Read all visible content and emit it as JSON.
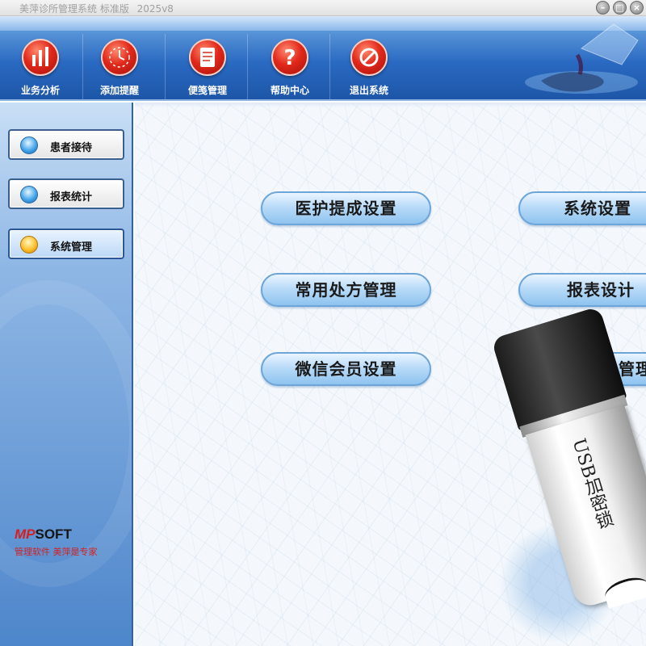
{
  "window": {
    "title": "美萍诊所管理系统 标准版",
    "version": "2025v8"
  },
  "toolbar": {
    "items": [
      {
        "label": "业务分析",
        "icon": "bar-chart-icon"
      },
      {
        "label": "添加提醒",
        "icon": "alarm-clock-icon"
      },
      {
        "label": "便笺管理",
        "icon": "notepad-icon"
      },
      {
        "label": "帮助中心",
        "icon": "question-mark-icon"
      },
      {
        "label": "退出系统",
        "icon": "no-entry-icon"
      }
    ]
  },
  "sidebar": {
    "items": [
      {
        "label": "患者接待",
        "active": false
      },
      {
        "label": "报表统计",
        "active": false
      },
      {
        "label": "系统管理",
        "active": true
      }
    ],
    "brand": {
      "logo_mp": "MP",
      "logo_soft": "SOFT",
      "slogan": "管理软件 美萍是专家"
    }
  },
  "main": {
    "buttons": [
      "医护提成设置",
      "系统设置",
      "常用处方管理",
      "报表设计",
      "微信会员设置",
      "配伍禁忌管理"
    ],
    "usb_key_label": "USB加密锁"
  },
  "colors": {
    "accent_red": "#e2291b",
    "toolbar_blue": "#2a6ac2",
    "pill_blue": "#b9dbf8",
    "brand_red": "#d42020"
  }
}
